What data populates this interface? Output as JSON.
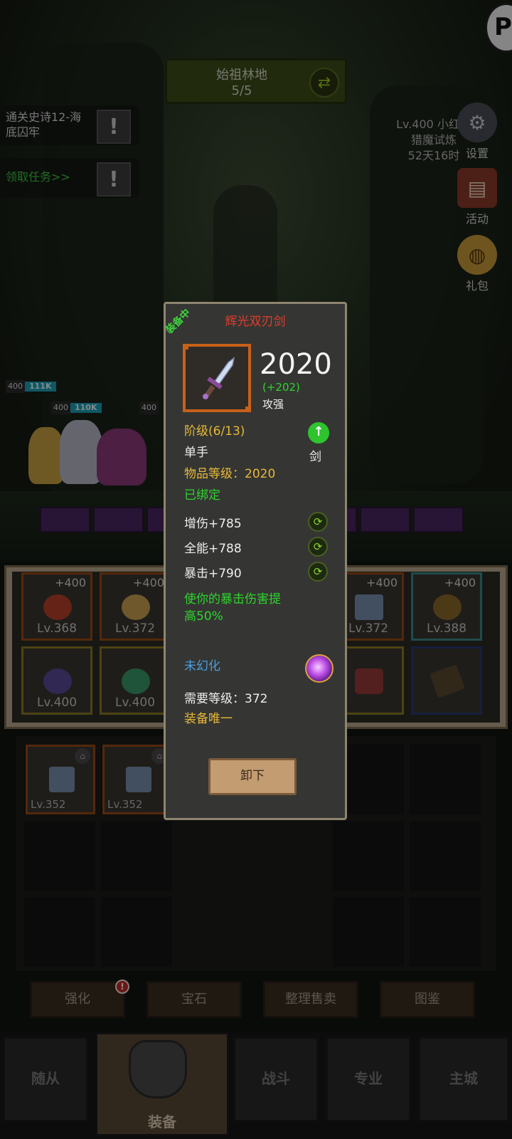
{
  "stage": {
    "name": "始祖林地",
    "progress": "5/5"
  },
  "quests": [
    {
      "text": "通关史诗12-海底囚牢"
    },
    {
      "text": "领取任务>>"
    }
  ],
  "hunt_info": {
    "line1": "Lv.400 小红莓",
    "line2": "猎魔试炼",
    "line3": "52天16时"
  },
  "side_buttons": [
    {
      "label": "设置",
      "icon": "gear-icon"
    },
    {
      "label": "活动",
      "icon": "scroll-icon"
    },
    {
      "label": "礼包",
      "icon": "gift-icon"
    }
  ],
  "hp_bars": [
    {
      "level": "400",
      "value": "111K"
    },
    {
      "level": "400",
      "value": "110K"
    },
    {
      "level": "400",
      "value": ""
    }
  ],
  "equip_slots": [
    {
      "plus": "+400",
      "level": "Lv.368"
    },
    {
      "plus": "+400",
      "level": "Lv.372"
    },
    {
      "plus": "+400",
      "level": "Lv.372"
    },
    {
      "plus": "+400",
      "level": "Lv.388"
    },
    {
      "plus": "",
      "level": "Lv.400"
    },
    {
      "plus": "",
      "level": "Lv.400"
    },
    {
      "plus": "",
      "level": ""
    },
    {
      "plus": "",
      "level": ""
    }
  ],
  "bag_items": [
    {
      "level": "Lv.352"
    },
    {
      "level": "Lv.352"
    }
  ],
  "tooltip": {
    "badge": "装备中",
    "name": "辉光双刃剑",
    "power": "2020",
    "power_diff": "(+202)",
    "power_tag": "攻强",
    "tier": "阶级(6/13)",
    "hand": "单手",
    "weapon_type": "剑",
    "item_level": "物品等级：2020",
    "bound": "已绑定",
    "stats": [
      "增伤+785",
      "全能+788",
      "暴击+790"
    ],
    "effect_line1": "使你的暴击伤害提",
    "effect_line2": "高50%",
    "illusion": "未幻化",
    "required_level": "需要等级：372",
    "unique": "装备唯一",
    "unequip_label": "卸下"
  },
  "tools": [
    {
      "label": "强化"
    },
    {
      "label": "宝石"
    },
    {
      "label": "整理售卖"
    },
    {
      "label": "图鉴"
    }
  ],
  "tool_badge": "!",
  "nav": [
    {
      "label": "随从"
    },
    {
      "label": "装备"
    },
    {
      "label": "战斗"
    },
    {
      "label": "专业"
    },
    {
      "label": "主城"
    }
  ],
  "colors": {
    "item_name": "#e03c2c",
    "gold_text": "#e8b838",
    "green_text": "#2ed42e",
    "blue_text": "#4a9ce0",
    "rarity_border": "#c8601a"
  }
}
